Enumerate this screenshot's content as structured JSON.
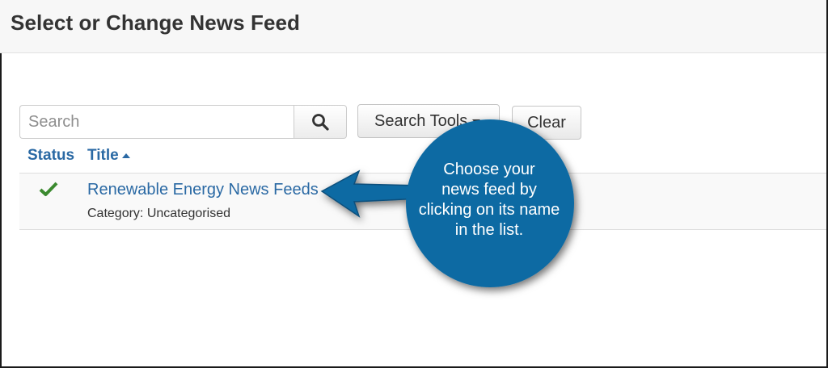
{
  "header": {
    "title": "Select or Change News Feed"
  },
  "toolbar": {
    "search_placeholder": "Search",
    "search_tools_label": "Search Tools",
    "clear_label": "Clear"
  },
  "table": {
    "columns": [
      "Status",
      "Title"
    ],
    "rows": [
      {
        "status": "published",
        "title": "Renewable Energy News Feeds",
        "category": "Category: Uncategorised"
      }
    ]
  },
  "callout": {
    "lines": [
      "Choose your",
      "news feed by",
      "clicking on its name",
      "in the list."
    ],
    "color": "#0f6aa3"
  },
  "icons": {
    "search": "magnifier-icon",
    "status": "checkmark-icon",
    "dropdown": "caret-down-icon",
    "sort": "sort-asc-icon"
  },
  "colors": {
    "link": "#2a69a4",
    "check": "#3b8a2f"
  }
}
